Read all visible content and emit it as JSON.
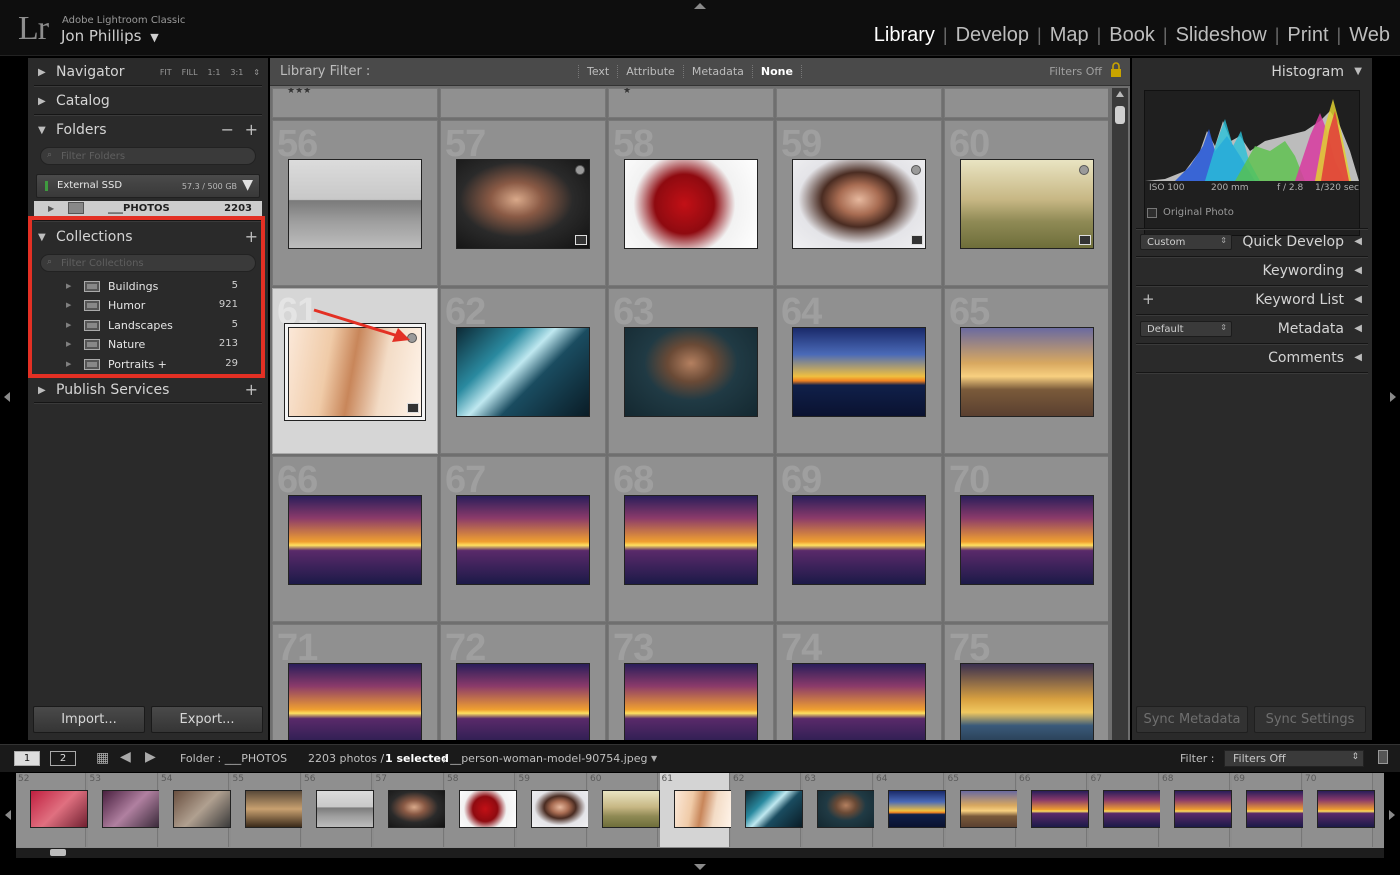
{
  "app": {
    "name": "Adobe Lightroom Classic",
    "logo": "Lr",
    "user": "Jon Phillips",
    "user_menu_icon": "chevron-down-icon"
  },
  "modules": [
    "Library",
    "Develop",
    "Map",
    "Book",
    "Slideshow",
    "Print",
    "Web"
  ],
  "active_module": "Library",
  "left_panel": {
    "navigator": {
      "label": "Navigator",
      "zoom": [
        "FIT",
        "FILL",
        "1:1",
        "3:1"
      ]
    },
    "catalog": {
      "label": "Catalog"
    },
    "folders": {
      "label": "Folders",
      "filter_placeholder": "Filter Folders",
      "volume": {
        "name": "External SSD",
        "size": "57.3 / 500 GB"
      },
      "folder": {
        "name": "___PHOTOS",
        "count": "2203"
      }
    },
    "collections": {
      "label": "Collections",
      "filter_placeholder": "Filter Collections",
      "items": [
        {
          "name": "Buildings",
          "count": "5"
        },
        {
          "name": "Humor",
          "count": "921"
        },
        {
          "name": "Landscapes",
          "count": "5"
        },
        {
          "name": "Nature",
          "count": "213"
        },
        {
          "name": "Portraits +",
          "count": "29"
        }
      ]
    },
    "publish": {
      "label": "Publish Services"
    },
    "import_label": "Import...",
    "export_label": "Export..."
  },
  "filter_bar": {
    "title": "Library Filter :",
    "options": [
      "Text",
      "Attribute",
      "Metadata",
      "None"
    ],
    "selected": "None",
    "status": "Filters Off"
  },
  "grid": {
    "top_row_stars": [
      "★★★",
      "",
      "★",
      "",
      ""
    ],
    "cells": [
      {
        "num": "56",
        "subject": "louvre-pyramid"
      },
      {
        "num": "57",
        "subject": "woman-fur-coat"
      },
      {
        "num": "58",
        "subject": "red-roses"
      },
      {
        "num": "59",
        "subject": "woman-portrait"
      },
      {
        "num": "60",
        "subject": "woman-sunglasses-field"
      },
      {
        "num": "61",
        "subject": "woman-model",
        "selected": true
      },
      {
        "num": "62",
        "subject": "glass-building"
      },
      {
        "num": "63",
        "subject": "child-portrait"
      },
      {
        "num": "64",
        "subject": "sunset-sea"
      },
      {
        "num": "65",
        "subject": "sunset-beach"
      },
      {
        "num": "66",
        "subject": "sunset"
      },
      {
        "num": "67",
        "subject": "sunset"
      },
      {
        "num": "68",
        "subject": "sunset"
      },
      {
        "num": "69",
        "subject": "sunset"
      },
      {
        "num": "70",
        "subject": "sunset"
      },
      {
        "num": "71",
        "subject": "sunset"
      },
      {
        "num": "72",
        "subject": "sunset"
      },
      {
        "num": "73",
        "subject": "sunset"
      },
      {
        "num": "74",
        "subject": "sunset"
      },
      {
        "num": "75",
        "subject": "sunset-waves"
      }
    ]
  },
  "right_panel": {
    "histogram": {
      "label": "Histogram",
      "iso": "ISO 100",
      "focal": "200 mm",
      "aperture": "f / 2.8",
      "shutter": "1/320 sec",
      "original_photo": "Original Photo"
    },
    "quick_develop": {
      "label": "Quick Develop",
      "preset": "Custom"
    },
    "keywording": {
      "label": "Keywording"
    },
    "keyword_list": {
      "label": "Keyword List"
    },
    "metadata": {
      "label": "Metadata",
      "preset": "Default"
    },
    "comments": {
      "label": "Comments"
    },
    "sync_metadata": "Sync Metadata",
    "sync_settings": "Sync Settings"
  },
  "film_bar": {
    "view1": "1",
    "view2": "2",
    "source": "Folder : ___PHOTOS",
    "count_text": "2203 photos /",
    "selected_text": "1 selected",
    "file_text": "/ __person-woman-model-90754.jpeg",
    "filter_label": "Filter :",
    "filter_value": "Filters Off"
  },
  "filmstrip": {
    "items": [
      {
        "num": "52"
      },
      {
        "num": "53"
      },
      {
        "num": "54"
      },
      {
        "num": "55"
      },
      {
        "num": "56"
      },
      {
        "num": "57"
      },
      {
        "num": "58"
      },
      {
        "num": "59"
      },
      {
        "num": "60"
      },
      {
        "num": "61",
        "selected": true
      },
      {
        "num": "62"
      },
      {
        "num": "63"
      },
      {
        "num": "64"
      },
      {
        "num": "65"
      },
      {
        "num": "66"
      },
      {
        "num": "67"
      },
      {
        "num": "68"
      },
      {
        "num": "69"
      },
      {
        "num": "70"
      }
    ]
  },
  "colors": {
    "highlight": "#e33024",
    "panel": "#2a2a2a",
    "grid_bg": "#6f6f6f"
  }
}
